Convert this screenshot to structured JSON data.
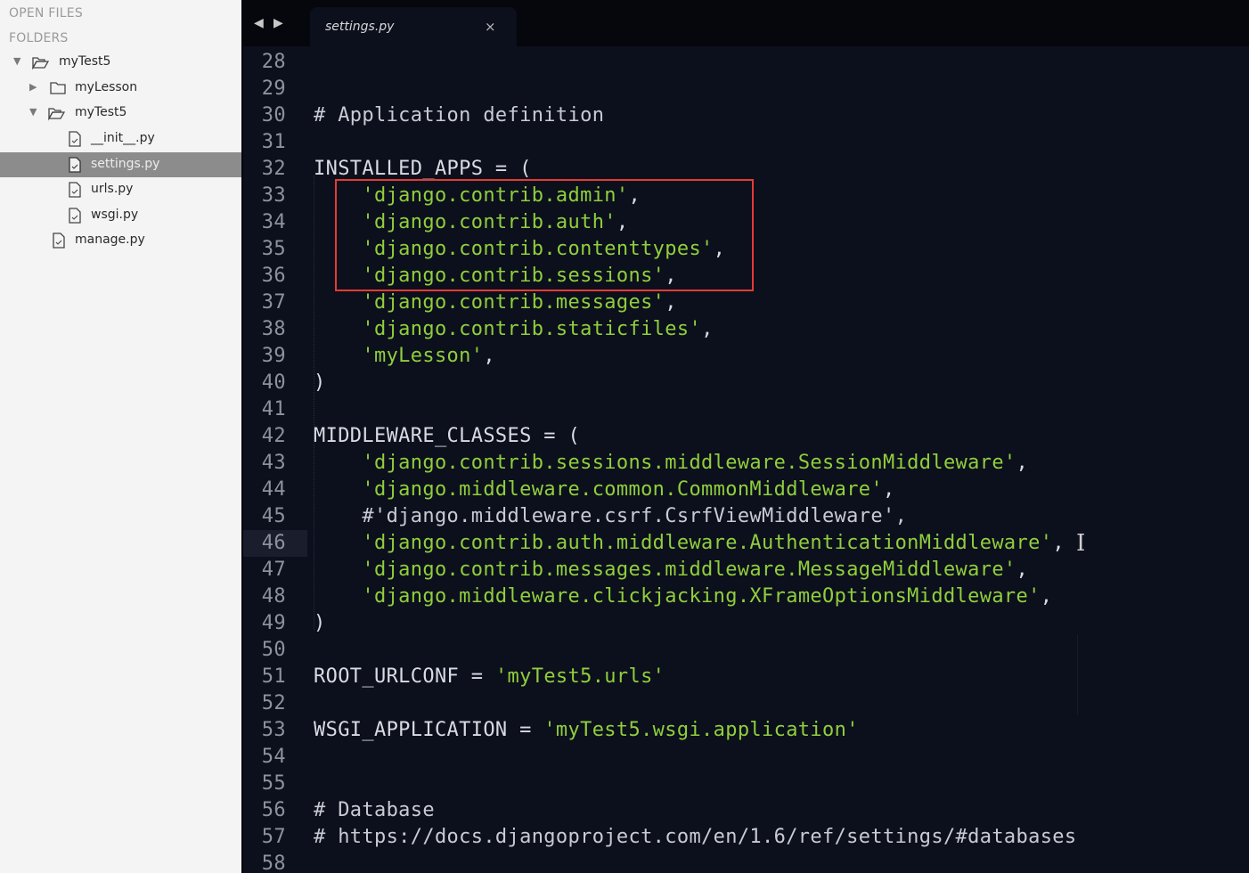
{
  "sidebar": {
    "open_files_heading": "OPEN FILES",
    "folders_heading": "FOLDERS",
    "tree": [
      {
        "label": "myTest5",
        "type": "folder-open",
        "expanded": true
      },
      {
        "label": "myLesson",
        "type": "folder",
        "expanded": false
      },
      {
        "label": "myTest5",
        "type": "folder-open",
        "expanded": true
      },
      {
        "label": "__init__.py",
        "type": "file"
      },
      {
        "label": "settings.py",
        "type": "file",
        "selected": true
      },
      {
        "label": "urls.py",
        "type": "file"
      },
      {
        "label": "wsgi.py",
        "type": "file"
      },
      {
        "label": "manage.py",
        "type": "file"
      }
    ]
  },
  "tabs": {
    "prev_icon": "◀",
    "next_icon": "▶",
    "active_tab": "settings.py",
    "close_icon": "×"
  },
  "editor": {
    "active_line": 46,
    "lines": [
      {
        "n": "28",
        "parts": []
      },
      {
        "n": "29",
        "parts": []
      },
      {
        "n": "30",
        "parts": [
          {
            "t": "# Application definition",
            "k": "c"
          }
        ]
      },
      {
        "n": "31",
        "parts": []
      },
      {
        "n": "32",
        "parts": [
          {
            "t": "INSTALLED_APPS = (",
            "k": "p"
          }
        ]
      },
      {
        "n": "33",
        "parts": [
          {
            "t": "    ",
            "k": "p"
          },
          {
            "t": "'django.contrib.admin'",
            "k": "s"
          },
          {
            "t": ",",
            "k": "p"
          }
        ]
      },
      {
        "n": "34",
        "parts": [
          {
            "t": "    ",
            "k": "p"
          },
          {
            "t": "'django.contrib.auth'",
            "k": "s"
          },
          {
            "t": ",",
            "k": "p"
          }
        ]
      },
      {
        "n": "35",
        "parts": [
          {
            "t": "    ",
            "k": "p"
          },
          {
            "t": "'django.contrib.contenttypes'",
            "k": "s"
          },
          {
            "t": ",",
            "k": "p"
          }
        ]
      },
      {
        "n": "36",
        "parts": [
          {
            "t": "    ",
            "k": "p"
          },
          {
            "t": "'django.contrib.sessions'",
            "k": "s"
          },
          {
            "t": ",",
            "k": "p"
          }
        ]
      },
      {
        "n": "37",
        "parts": [
          {
            "t": "    ",
            "k": "p"
          },
          {
            "t": "'django.contrib.messages'",
            "k": "s"
          },
          {
            "t": ",",
            "k": "p"
          }
        ]
      },
      {
        "n": "38",
        "parts": [
          {
            "t": "    ",
            "k": "p"
          },
          {
            "t": "'django.contrib.staticfiles'",
            "k": "s"
          },
          {
            "t": ",",
            "k": "p"
          }
        ]
      },
      {
        "n": "39",
        "parts": [
          {
            "t": "    ",
            "k": "p"
          },
          {
            "t": "'myLesson'",
            "k": "s"
          },
          {
            "t": ",",
            "k": "p"
          }
        ]
      },
      {
        "n": "40",
        "parts": [
          {
            "t": ")",
            "k": "p"
          }
        ]
      },
      {
        "n": "41",
        "parts": []
      },
      {
        "n": "42",
        "parts": [
          {
            "t": "MIDDLEWARE_CLASSES = (",
            "k": "p"
          }
        ]
      },
      {
        "n": "43",
        "parts": [
          {
            "t": "    ",
            "k": "p"
          },
          {
            "t": "'django.contrib.sessions.middleware.SessionMiddleware'",
            "k": "s"
          },
          {
            "t": ",",
            "k": "p"
          }
        ]
      },
      {
        "n": "44",
        "parts": [
          {
            "t": "    ",
            "k": "p"
          },
          {
            "t": "'django.middleware.common.CommonMiddleware'",
            "k": "s"
          },
          {
            "t": ",",
            "k": "p"
          }
        ]
      },
      {
        "n": "45",
        "parts": [
          {
            "t": "    #'django.middleware.csrf.CsrfViewMiddleware',",
            "k": "c"
          }
        ]
      },
      {
        "n": "46",
        "parts": [
          {
            "t": "    ",
            "k": "p"
          },
          {
            "t": "'django.contrib.auth.middleware.AuthenticationMiddleware'",
            "k": "s"
          },
          {
            "t": ",",
            "k": "p"
          }
        ]
      },
      {
        "n": "47",
        "parts": [
          {
            "t": "    ",
            "k": "p"
          },
          {
            "t": "'django.contrib.messages.middleware.MessageMiddleware'",
            "k": "s"
          },
          {
            "t": ",",
            "k": "p"
          }
        ]
      },
      {
        "n": "48",
        "parts": [
          {
            "t": "    ",
            "k": "p"
          },
          {
            "t": "'django.middleware.clickjacking.XFrameOptionsMiddleware'",
            "k": "s"
          },
          {
            "t": ",",
            "k": "p"
          }
        ]
      },
      {
        "n": "49",
        "parts": [
          {
            "t": ")",
            "k": "p"
          }
        ]
      },
      {
        "n": "50",
        "parts": []
      },
      {
        "n": "51",
        "parts": [
          {
            "t": "ROOT_URLCONF = ",
            "k": "p"
          },
          {
            "t": "'myTest5.urls'",
            "k": "s"
          }
        ]
      },
      {
        "n": "52",
        "parts": []
      },
      {
        "n": "53",
        "parts": [
          {
            "t": "WSGI_APPLICATION = ",
            "k": "p"
          },
          {
            "t": "'myTest5.wsgi.application'",
            "k": "s"
          }
        ]
      },
      {
        "n": "54",
        "parts": []
      },
      {
        "n": "55",
        "parts": []
      },
      {
        "n": "56",
        "parts": [
          {
            "t": "# Database",
            "k": "c"
          }
        ]
      },
      {
        "n": "57",
        "parts": [
          {
            "t": "# https://docs.djangoproject.com/en/1.6/ref/settings/#databases",
            "k": "c"
          }
        ]
      },
      {
        "n": "58",
        "parts": []
      }
    ]
  },
  "colors": {
    "editor_bg": "#0c0f1c",
    "string": "#8fcf3c",
    "plain": "#d9dbe3",
    "highlight_box": "#e43b35"
  }
}
